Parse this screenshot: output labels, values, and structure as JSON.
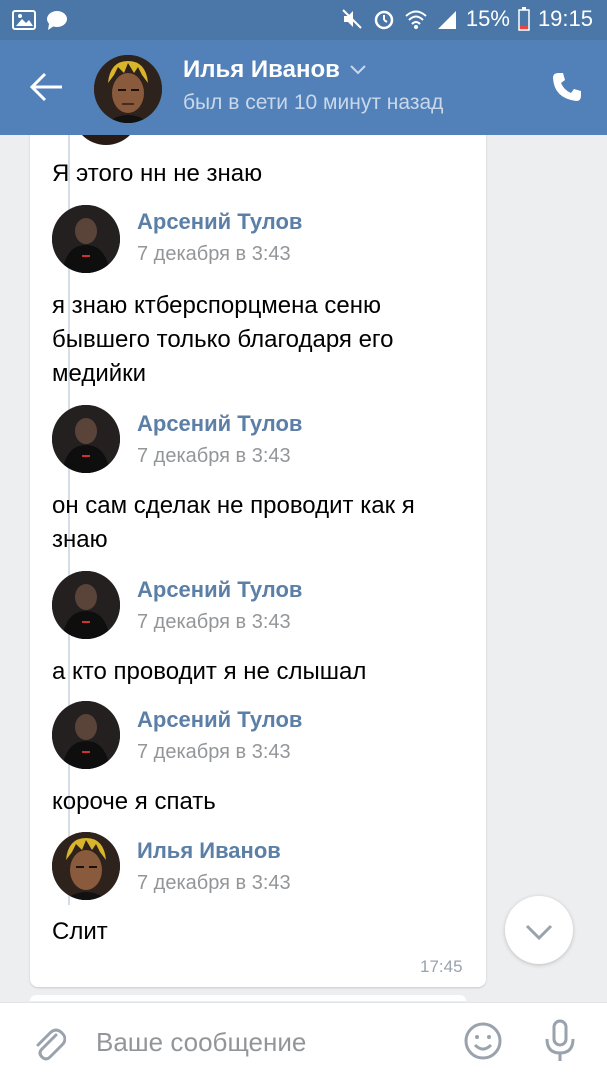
{
  "status_bar": {
    "battery": "15%",
    "time": "19:15"
  },
  "header": {
    "name": "Илья Иванов",
    "status": "был в сети 10 минут назад"
  },
  "messages": [
    {
      "type": "text",
      "text": "Я этого нн не знаю"
    },
    {
      "type": "forward",
      "name": "Арсений Тулов",
      "date": "7 декабря в 3:43",
      "text": "я знаю ктберспорцмена сеню бывшего только благодаря его медийки"
    },
    {
      "type": "forward",
      "name": "Арсений Тулов",
      "date": "7 декабря в 3:43",
      "text": "он сам сделак не проводит как я знаю"
    },
    {
      "type": "forward",
      "name": "Арсений Тулов",
      "date": "7 декабря в 3:43",
      "text": "а кто проводит я не слышал"
    },
    {
      "type": "forward",
      "name": "Арсений Тулов",
      "date": "7 декабря в 3:43",
      "text": "короче я спать"
    },
    {
      "type": "forward",
      "name": "Илья Иванов",
      "date": "7 декабря в 3:43",
      "text": "Слит"
    }
  ],
  "message_time": "17:45",
  "composer": {
    "placeholder": "Ваше сообщение"
  },
  "colors": {
    "status_bar": "#4a76a8",
    "app_bar": "#5181b8",
    "link_name": "#5b7fa6"
  }
}
